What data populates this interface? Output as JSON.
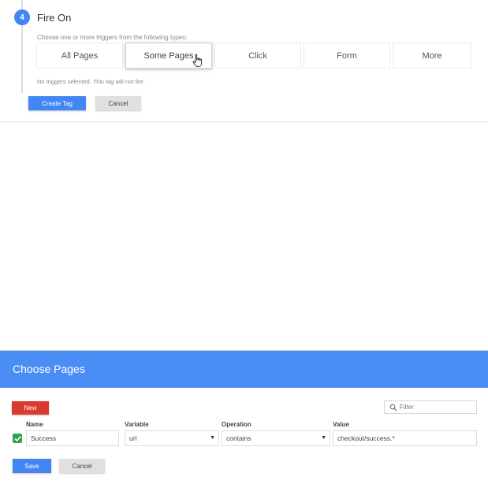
{
  "fire_on": {
    "step_number": "4",
    "title": "Fire On",
    "description": "Choose one or more triggers from the following types:",
    "triggers": [
      "All Pages",
      "Some Pages",
      "Click",
      "Form",
      "More"
    ],
    "active_trigger": "Some Pages",
    "status_text": "No triggers selected. This tag will not fire.",
    "create_label": "Create Tag",
    "cancel_label": "Cancel"
  },
  "dialog": {
    "title": "Choose Pages",
    "new_label": "New",
    "filter_placeholder": "Filter",
    "columns": {
      "name": "Name",
      "variable": "Variable",
      "operation": "Operation",
      "value": "Value"
    },
    "row": {
      "checked": true,
      "name": "Success",
      "variable": "url",
      "operation": "contains",
      "value": "checkout/success.*"
    },
    "save_label": "Save",
    "cancel_label": "Cancel"
  },
  "colors": {
    "accent": "#4285f4",
    "header": "#4a8ef5",
    "danger": "#d93b30",
    "success": "#31a354"
  },
  "icons": [
    "pointer-hand-icon",
    "search-icon",
    "checkmark-icon",
    "dropdown-caret-icon"
  ]
}
